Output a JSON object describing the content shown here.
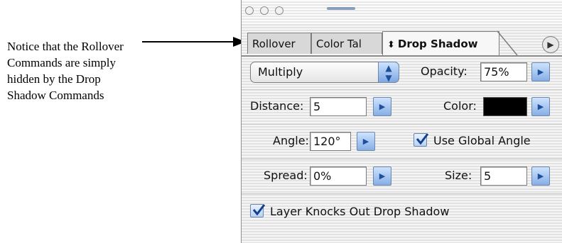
{
  "annotation": {
    "lines": [
      "Notice that the Rollover",
      "Commands are simply",
      "hidden by the Drop",
      "Shadow Commands"
    ]
  },
  "palette": {
    "tabs": [
      {
        "label": "Rollover"
      },
      {
        "label": "Color Tal"
      },
      {
        "label": "Drop Shadow"
      }
    ],
    "blend_mode": "Multiply",
    "opacity": {
      "label": "Opacity:",
      "value": "75%"
    },
    "distance": {
      "label": "Distance:",
      "value": "5"
    },
    "color": {
      "label": "Color:",
      "swatch": "#000000"
    },
    "angle": {
      "label": "Angle:",
      "value": "120°"
    },
    "use_global_angle": {
      "label": "Use Global Angle",
      "checked": true
    },
    "spread": {
      "label": "Spread:",
      "value": "0%"
    },
    "size": {
      "label": "Size:",
      "value": "5"
    },
    "layer_knocks_out": {
      "label": "Layer Knocks Out Drop Shadow",
      "checked": true
    }
  }
}
